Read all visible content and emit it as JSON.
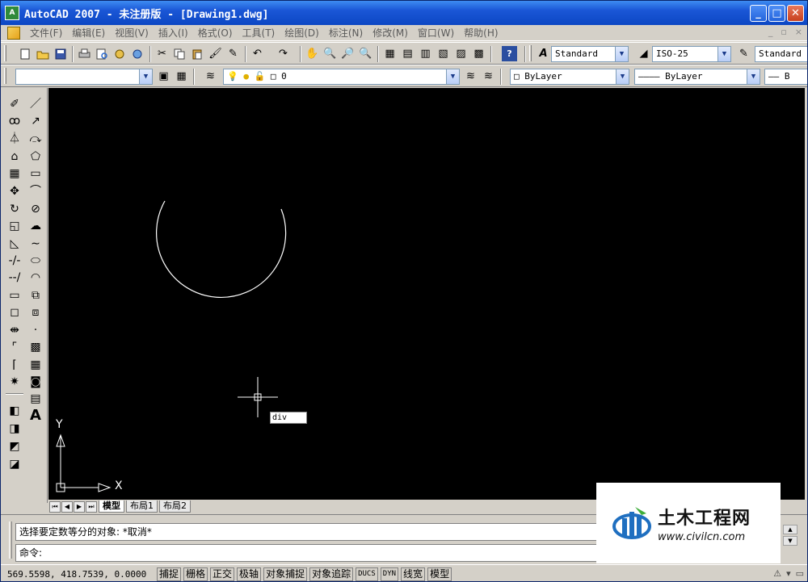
{
  "window": {
    "title": "AutoCAD 2007 - 未注册版 - [Drawing1.dwg]",
    "app_icon_text": "A",
    "minimize": "_",
    "maximize": "□",
    "close": "✕"
  },
  "menu": {
    "items": [
      "文件(F)",
      "编辑(E)",
      "视图(V)",
      "插入(I)",
      "格式(O)",
      "工具(T)",
      "绘图(D)",
      "标注(N)",
      "修改(M)",
      "窗口(W)",
      "帮助(H)"
    ],
    "doc_controls": [
      "_",
      "▫",
      "×"
    ]
  },
  "toolbar_styles": {
    "text_style": "Standard",
    "dim_style": "ISO-25",
    "table_style": "Standard"
  },
  "toolbar_layers": {
    "layer_name": "0",
    "color": "ByLayer",
    "linetype": "———— ByLayer",
    "lineweight": "—— B"
  },
  "canvas": {
    "background": "#000000",
    "entity_color": "#ffffff",
    "command_tooltip": "div",
    "ucs_y_label": "Y",
    "ucs_x_label": "X"
  },
  "layout_tabs": {
    "nav": [
      "⏮",
      "◀",
      "▶",
      "⏭"
    ],
    "tabs": [
      {
        "label": "模型",
        "active": true
      },
      {
        "label": "布局1",
        "active": false
      },
      {
        "label": "布局2",
        "active": false
      }
    ]
  },
  "command": {
    "history_line": "选择要定数等分的对象: *取消*",
    "prompt": "命令:"
  },
  "status": {
    "coords": "569.5598,  418.7539,  0.0000",
    "toggles": [
      "捕捉",
      "栅格",
      "正交",
      "极轴",
      "对象捕捉",
      "对象追踪",
      "DUCS",
      "DYN",
      "线宽",
      "模型"
    ]
  },
  "watermark": {
    "name": "土木工程网",
    "url": "www.civilcn.com"
  }
}
